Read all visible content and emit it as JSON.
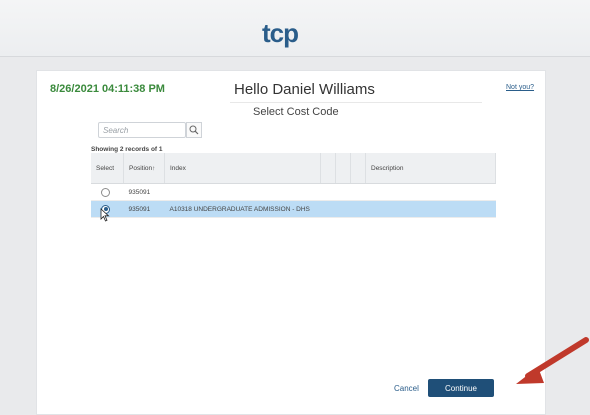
{
  "header": {
    "logo_text": "tcp"
  },
  "timestamp": "8/26/2021 04:11:38 PM",
  "greeting": "Hello Daniel Williams",
  "not_you_link": "Not you?",
  "subtitle": "Select Cost Code",
  "search": {
    "placeholder": "Search",
    "value": ""
  },
  "records_info": "Showing 2 records of 1",
  "table": {
    "columns": [
      "Select",
      "Position↑",
      "Index",
      "",
      "",
      "",
      "Description"
    ],
    "rows": [
      {
        "selected": false,
        "position": "935091",
        "index": "",
        "description": ""
      },
      {
        "selected": true,
        "position": "935091",
        "index": "A10318 UNDERGRADUATE ADMISSION - DHS",
        "description": ""
      }
    ]
  },
  "actions": {
    "cancel_label": "Cancel",
    "continue_label": "Continue"
  },
  "colors": {
    "brand_blue": "#2a5d8a",
    "timestamp_green": "#3a8a3c",
    "selected_row": "#bcdcf5",
    "arrow_red": "#c0392b"
  },
  "icons": {
    "search": "search-icon",
    "cursor": "mouse-pointer-icon",
    "annotation": "red-arrow-icon"
  }
}
